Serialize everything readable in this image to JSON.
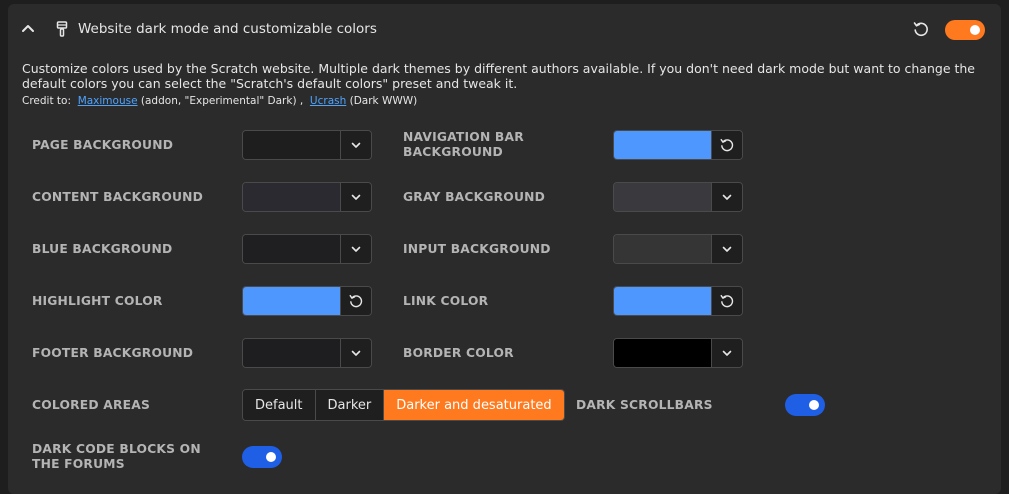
{
  "header": {
    "title": "Website dark mode and customizable colors",
    "enabled": true
  },
  "description": "Customize colors used by the Scratch website. Multiple dark themes by different authors available. If you don't need dark mode but want to change the default colors you can select the \"Scratch's default colors\" preset and tweak it.",
  "credit": {
    "prefix": "Credit to:",
    "author1": "Maximouse",
    "author1_note": "(addon, \"Experimental\" Dark) ,",
    "author2": "Ucrash",
    "author2_note": "(Dark WWW)"
  },
  "settings": {
    "page_background": {
      "label": "PAGE BACKGROUND",
      "color": "#1e1e1e"
    },
    "navbar_background": {
      "label": "NAVIGATION BAR BACKGROUND",
      "color": "#4d97ff"
    },
    "content_background": {
      "label": "CONTENT BACKGROUND",
      "color": "#2a2a30"
    },
    "gray_background": {
      "label": "GRAY BACKGROUND",
      "color": "#3a3a3e"
    },
    "blue_background": {
      "label": "BLUE BACKGROUND",
      "color": "#1f1f21"
    },
    "input_background": {
      "label": "INPUT BACKGROUND",
      "color": "#353535"
    },
    "highlight_color": {
      "label": "HIGHLIGHT COLOR",
      "color": "#4d97ff"
    },
    "link_color": {
      "label": "LINK COLOR",
      "color": "#4d97ff"
    },
    "footer_background": {
      "label": "FOOTER BACKGROUND",
      "color": "#1e1e20"
    },
    "border_color": {
      "label": "BORDER COLOR",
      "color": "#000000"
    },
    "colored_areas": {
      "label": "COLORED AREAS",
      "options": [
        "Default",
        "Darker",
        "Darker and desaturated"
      ],
      "selected": "Darker and desaturated"
    },
    "dark_scrollbars": {
      "label": "DARK SCROLLBARS",
      "enabled": true
    },
    "dark_code_blocks": {
      "label": "DARK CODE BLOCKS ON THE FORUMS",
      "enabled": true
    }
  },
  "colors": {
    "accent": "#ff7a1f",
    "toggle_on": "#1e5fe6",
    "link": "#4ea3ff"
  }
}
